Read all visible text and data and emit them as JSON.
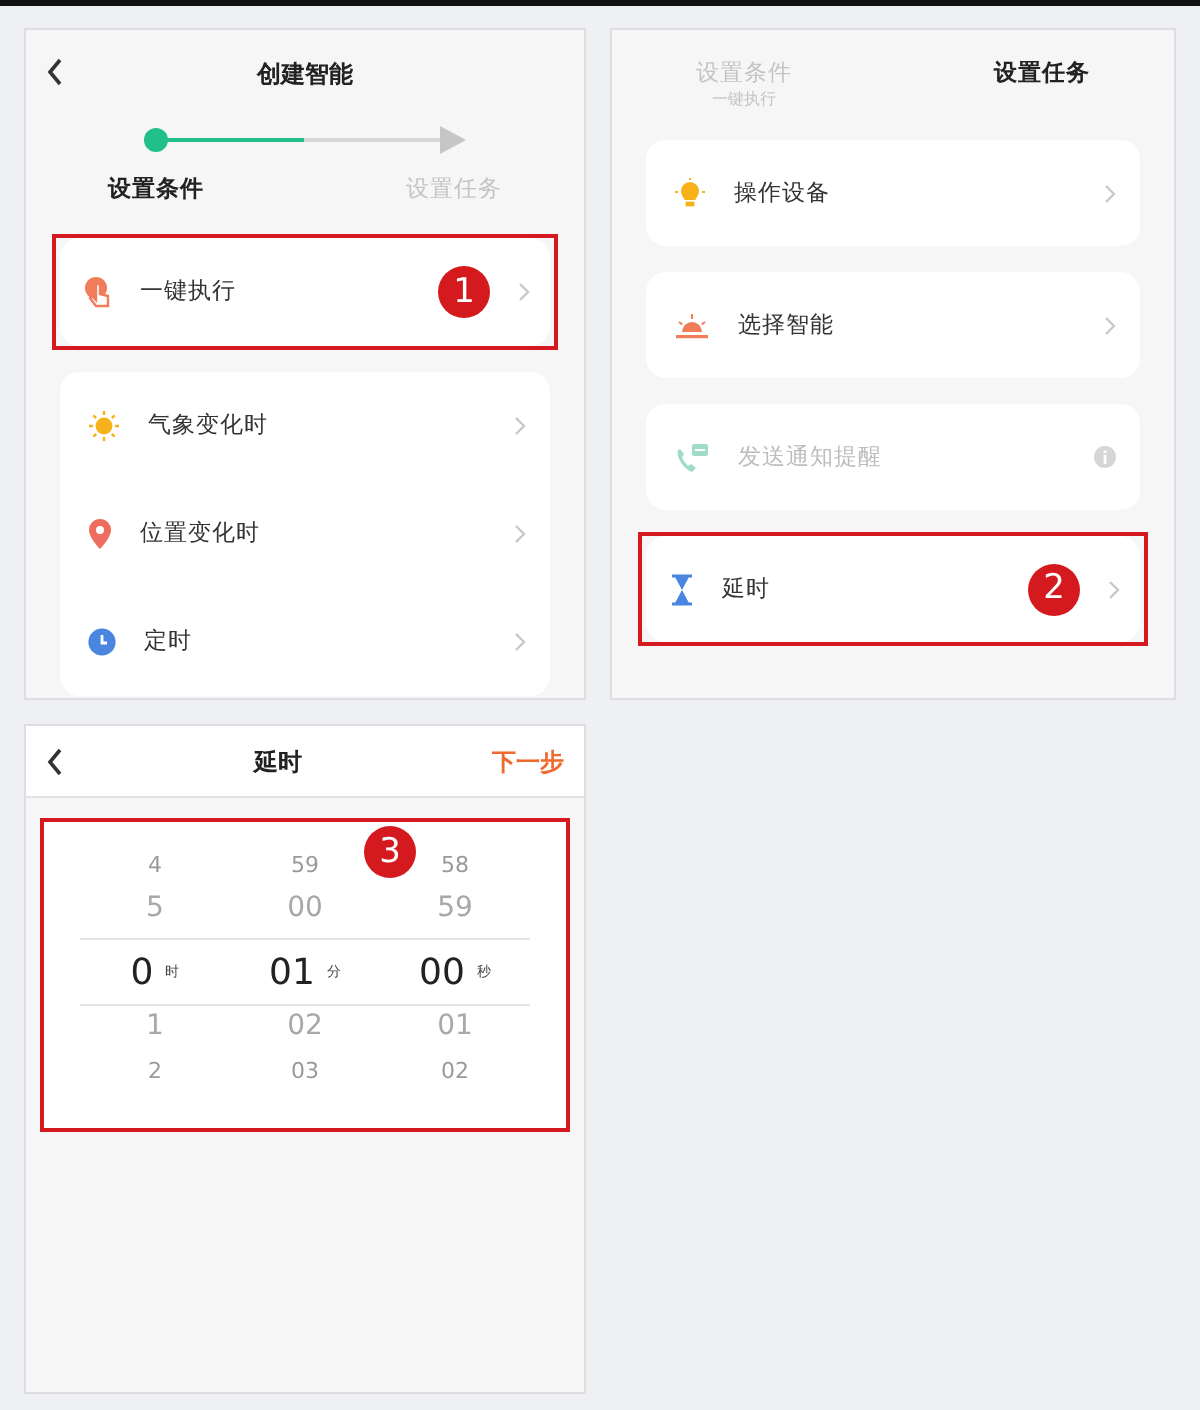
{
  "screens": [
    {
      "kind": "list",
      "title": "创建智能",
      "stepper": {
        "level": 0.5,
        "steps": [
          {
            "label": "设置条件",
            "selected": true
          },
          {
            "label": "设置任务",
            "selected": false
          }
        ]
      },
      "groups": [
        [
          {
            "label": "一键执行",
            "disabled": false,
            "annotation": "1"
          }
        ],
        [
          {
            "label": "气象变化时",
            "disabled": false
          },
          {
            "label": "位置变化时",
            "disabled": false
          },
          {
            "label": "定时",
            "disabled": false
          }
        ]
      ]
    },
    {
      "kind": "list",
      "stepper": {
        "steps": [
          {
            "label": "设置条件",
            "sub": "一键执行",
            "selected": false
          },
          {
            "label": "设置任务",
            "selected": true
          }
        ]
      },
      "groups": [
        [
          {
            "label": "操作设备",
            "disabled": false
          }
        ],
        [
          {
            "label": "选择智能",
            "disabled": false
          }
        ],
        [
          {
            "label": "发送通知提醒",
            "disabled": true
          }
        ],
        [
          {
            "label": "延时",
            "disabled": false,
            "annotation": "2"
          }
        ]
      ]
    },
    {
      "kind": "picker",
      "title": "延时",
      "action": "下一步",
      "annotation": "3",
      "columns": [
        {
          "unit": "时",
          "values": [
            "4",
            "5",
            "0",
            "1",
            "2"
          ]
        },
        {
          "unit": "分",
          "values": [
            "59",
            "00",
            "01",
            "02",
            "03"
          ]
        },
        {
          "unit": "秒",
          "values": [
            "58",
            "59",
            "00",
            "01",
            "02"
          ]
        }
      ]
    }
  ]
}
